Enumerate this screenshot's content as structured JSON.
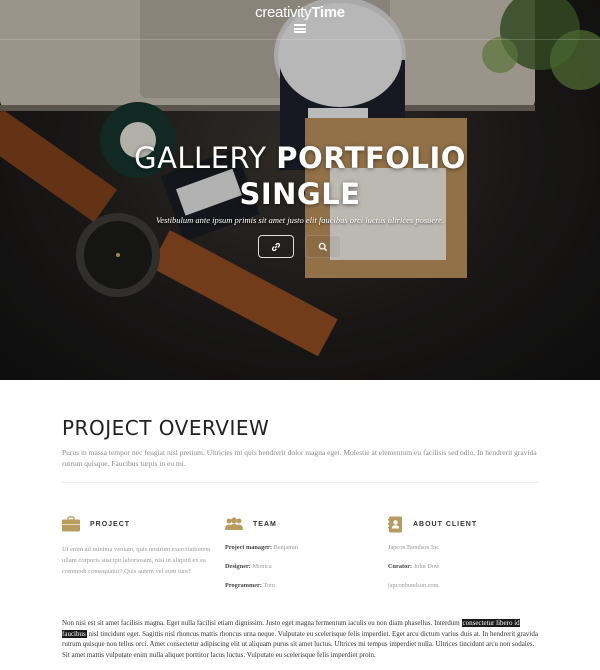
{
  "brand": {
    "part1": "creativity",
    "part2": "Time"
  },
  "hero": {
    "title_light": "GALLERY",
    "title_bold_1": "PORTFOLIO",
    "title_bold_2": "SINGLE",
    "subtitle": "Vestibulum ante ipsum primis sit amet justo elit faucibus orci luctus ultrices posuere."
  },
  "overview": {
    "title": "PROJECT OVERVIEW",
    "text": "Purus in massa tempor nec feugiat nisl pretium. Ultricies mi quis hendrerit dolor magna eget. Molestie at elementum eu facilisis sed odio. In hendrerit gravida rutrum quisque. Faucibus turpis in eu mi."
  },
  "columns": {
    "project": {
      "title": "PROJECT",
      "text": "Ut enim ad minima veniam, quis nostrum exercitationem ullam corporis suscipit laboriosam, nisi ut aliquid ex ea commodi consequatur? Quis autem vel eum iure?"
    },
    "team": {
      "title": "TEAM",
      "rows": [
        {
          "label": "Project manager:",
          "value": "Benjamin"
        },
        {
          "label": "Designer:",
          "value": "Monica"
        },
        {
          "label": "Programmer:",
          "value": "Tom"
        }
      ]
    },
    "client": {
      "title": "ABOUT CLIENT",
      "company": "Japcon Bundson Inc",
      "curator_label": "Curator:",
      "curator_value": "John Dow",
      "website": "japconbundson.com"
    }
  },
  "body": {
    "before": "Non nisi est sit amet facilisis magna. Eget nulla facilisi etiam dignissim. Justo eget magna fermentum iaculis eu non diam phasellus. Interdum ",
    "highlight": "consectetur libero id faucibus",
    "after": " nisl tincidunt eget. Sagittis nisl rhoncus mattis rhoncus urna neque. Vulputate eu scelerisque felis imperdiet. Eget arcu dictum varius duis at. In hendrerit gravida rutrum quisque non tellus orci. Amet consectetur adipiscing elit ut aliquam purus sit amet luctus. Ultrices mi tempus imperdiet nulla. Ultrices tincidunt arcu non sodales. Sit amet mattis vulputate enim nulla aliquet porttitor lacus luctus. Vulputate eu scelerisque felis imperdiet proin."
  },
  "colors": {
    "accent_gold": "#b89b5e",
    "heading": "#222222",
    "muted": "#999999"
  }
}
